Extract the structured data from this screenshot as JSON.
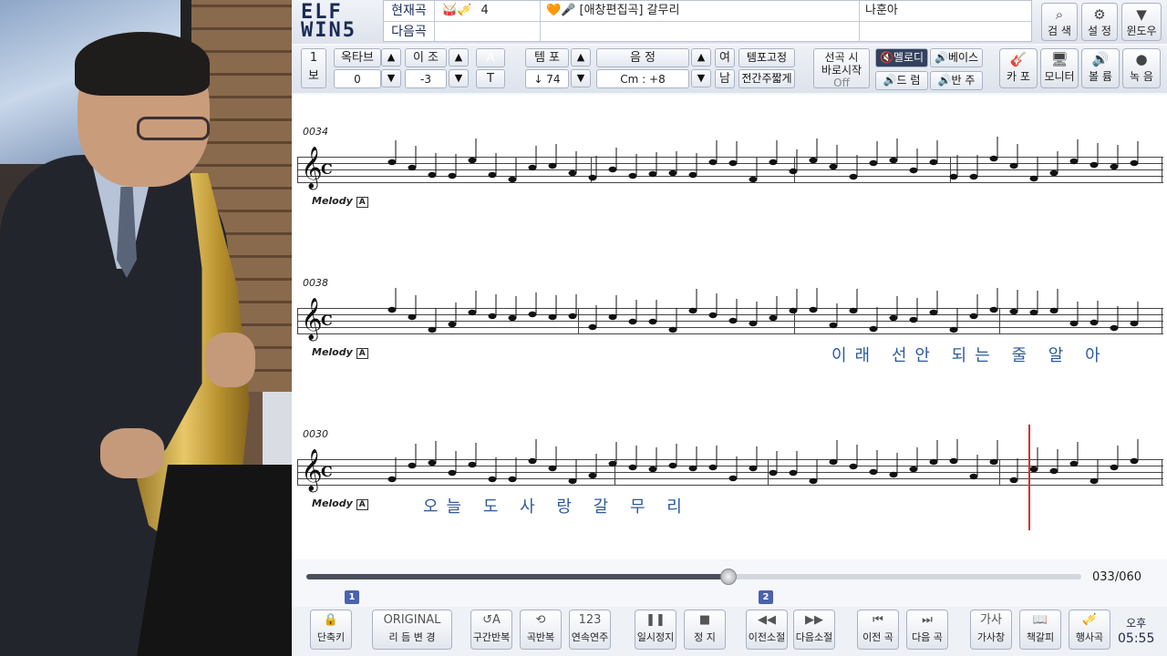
{
  "logo": {
    "line1": "ELF",
    "line2": "WIN5"
  },
  "song": {
    "current_label": "현재곡",
    "next_label": "다음곡",
    "current_icons": "🥁🎺",
    "current_number": "4",
    "current_title_icons": "🧡🎤",
    "current_title": "[애창편집곡] 갈무리",
    "singer": "나훈아"
  },
  "top_buttons": [
    {
      "icon": "⌕",
      "label": "검 색"
    },
    {
      "icon": "⚙",
      "label": "설 정"
    },
    {
      "icon": "▼",
      "label": "윈도우"
    }
  ],
  "controls": {
    "score_page": {
      "top": "1",
      "bottom": "보"
    },
    "octave": {
      "label": "옥타브",
      "value": "0"
    },
    "transpose": {
      "label": "이 조",
      "value": "-3"
    },
    "at": {
      "top": "A",
      "bottom": "T"
    },
    "tempo": {
      "label": "템 포",
      "value": "↓ 74"
    },
    "key": {
      "label": "음 정",
      "value": "Cm : +8"
    },
    "gender": {
      "top": "여",
      "bottom": "남"
    },
    "tempo_fix": "템포고정",
    "prelude_short": "전간주짧게",
    "instant_start": {
      "line1": "선곡 시",
      "line2": "바로시작",
      "state": "Off"
    },
    "melody": "🔇멜로디",
    "bass": "🔊베이스",
    "drum": "🔊드 럼",
    "accomp": "🔊반 주"
  },
  "right_buttons": [
    {
      "icon": "🎸",
      "label": "카 포"
    },
    {
      "icon": "🖥",
      "label": "모니터"
    },
    {
      "icon": "🔊",
      "label": "볼 륨"
    },
    {
      "icon": "●",
      "label": "녹 음"
    }
  ],
  "score": {
    "systems": [
      {
        "measure": "0034",
        "label": "Melody",
        "lyrics": ""
      },
      {
        "measure": "0038",
        "label": "Melody",
        "lyrics": "이래 선안 되는 줄  알 아"
      },
      {
        "measure": "0030",
        "label": "Melody",
        "lyrics": "오늘 도 사 랑  갈 무  리"
      }
    ],
    "badge": "A",
    "time_sig": "C"
  },
  "progress": {
    "fraction": 0.545,
    "text": "033/060",
    "markers": [
      "1",
      "2"
    ]
  },
  "bottom_buttons": [
    {
      "icon": "🔒",
      "label": "단축키"
    },
    {
      "icon": "ORIGINAL",
      "label": "리 듬 변 경"
    },
    {
      "icon": "↺A",
      "label": "구간반복"
    },
    {
      "icon": "⟲",
      "label": "곡반복"
    },
    {
      "icon": "123",
      "label": "연속연주"
    },
    {
      "icon": "❚❚",
      "label": "일시정지"
    },
    {
      "icon": "■",
      "label": "정 지"
    },
    {
      "icon": "◀◀",
      "label": "이전소절"
    },
    {
      "icon": "▶▶",
      "label": "다음소절"
    },
    {
      "icon": "⏮",
      "label": "이전 곡"
    },
    {
      "icon": "⏭",
      "label": "다음 곡"
    },
    {
      "icon": "가사",
      "label": "가사창"
    },
    {
      "icon": "📖",
      "label": "책갈피"
    },
    {
      "icon": "🎺",
      "label": "행사곡"
    }
  ],
  "clock": {
    "ampm": "오후",
    "time": "05:55"
  }
}
